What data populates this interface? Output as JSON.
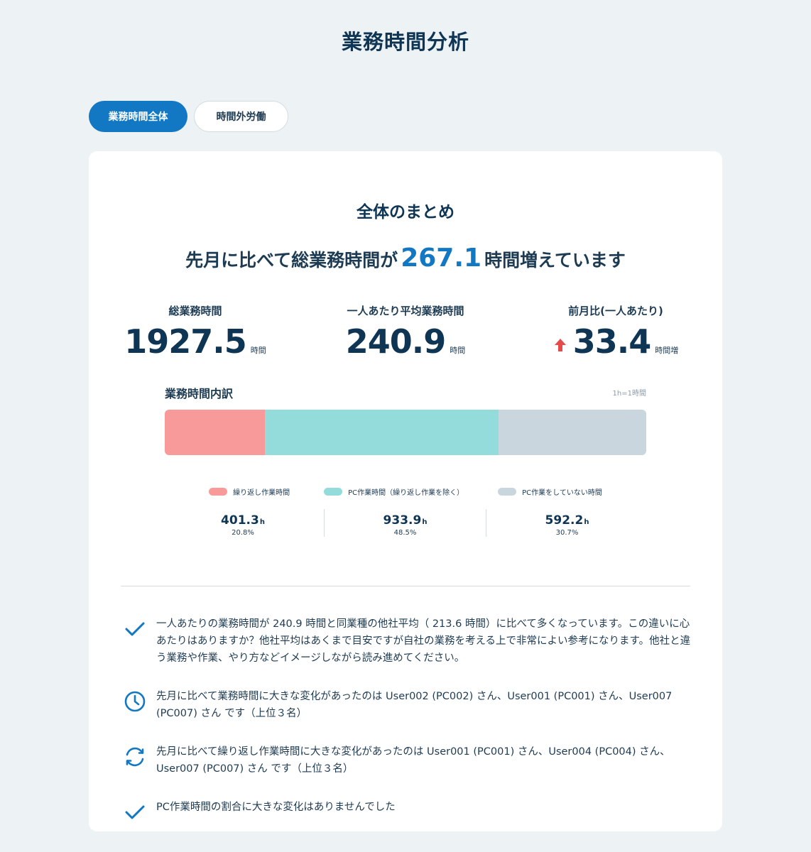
{
  "page": {
    "title": "業務時間分析"
  },
  "tabs": [
    {
      "label": "業務時間全体",
      "active": true
    },
    {
      "label": "時間外労働",
      "active": false
    }
  ],
  "summary": {
    "title": "全体のまとめ",
    "headline_pre": "先月に比べて総業務時間が",
    "headline_value": "267.1",
    "headline_post": "時間増えています"
  },
  "stats": {
    "total": {
      "label": "総業務時間",
      "value": "1927.5",
      "unit": "時間"
    },
    "avg": {
      "label": "一人あたり平均業務時間",
      "value": "240.9",
      "unit": "時間"
    },
    "mom": {
      "label": "前月比(一人あたり)",
      "value": "33.4",
      "unit": "時間増",
      "direction": "up"
    }
  },
  "breakdown": {
    "title": "業務時間内訳",
    "scale_note": "1h=1時間",
    "items": [
      {
        "label": "繰り返し作業時間",
        "value": "401.3",
        "unit": "h",
        "percent": "20.8%",
        "share": 0.208,
        "color": "#f99a9a"
      },
      {
        "label": "PC作業時間（繰り返し作業を除く）",
        "value": "933.9",
        "unit": "h",
        "percent": "48.5%",
        "share": 0.485,
        "color": "#93dcdb"
      },
      {
        "label": "PC作業をしていない時間",
        "value": "592.2",
        "unit": "h",
        "percent": "30.7%",
        "share": 0.307,
        "color": "#cad6de"
      }
    ]
  },
  "notes": [
    {
      "icon": "check-icon",
      "text": "一人あたりの業務時間が 240.9 時間と同業種の他社平均（ 213.6 時間）に比べて多くなっています。この違いに心あたりはありますか？他社平均はあくまで目安ですが自社の業務を考える上で非常によい参考になります。他社と違う業務や作業、やり方などイメージしながら読み進めてください。"
    },
    {
      "icon": "clock-icon",
      "text": "先月に比べて業務時間に大きな変化があったのは User002 (PC002) さん、User001 (PC001) さん、User007 (PC007) さん です（上位３名）"
    },
    {
      "icon": "refresh-icon",
      "text": "先月に比べて繰り返し作業時間に大きな変化があったのは User001 (PC001) さん、User004 (PC004) さん、User007 (PC007) さん です（上位３名）"
    },
    {
      "icon": "check-icon",
      "text": "PC作業時間の割合に大きな変化はありませんでした"
    }
  ],
  "colors": {
    "accent": "#1278c3",
    "up_arrow": "#e64b4b",
    "title": "#0f3554"
  }
}
